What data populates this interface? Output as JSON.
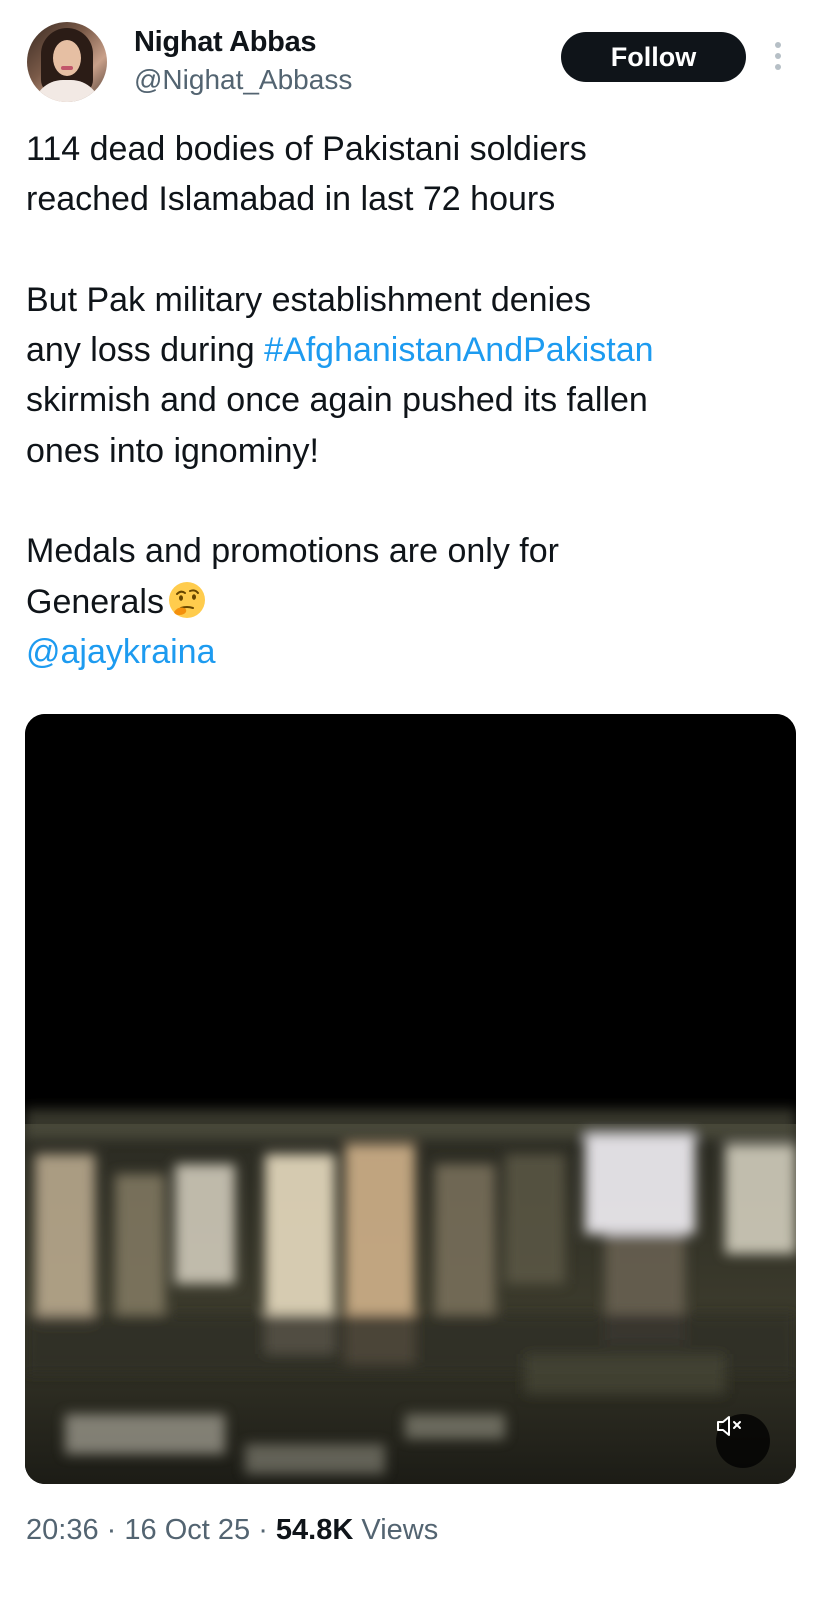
{
  "author": {
    "display_name": "Nighat Abbas",
    "handle": "@Nighat_Abbass",
    "avatar_icon": "profile-photo"
  },
  "header": {
    "follow_label": "Follow",
    "more_icon": "vertical-ellipsis-icon"
  },
  "tweet": {
    "paragraph1": {
      "line1": "114 dead bodies of Pakistani soldiers",
      "line2": "reached Islamabad in last 72 hours"
    },
    "paragraph2": {
      "line1": "But Pak military establishment denies",
      "line2_prefix": "any loss during ",
      "hashtag": "#AfghanistanAndPakistan",
      "line3": "skirmish and once again pushed its fallen",
      "line4": "ones into ignominy!"
    },
    "paragraph3": {
      "line1": "Medals and promotions are only for",
      "line2": "Generals",
      "emoji": "thinking-face-emoji",
      "mention": "@ajaykraina"
    }
  },
  "media": {
    "type": "video",
    "mute_icon": "speaker-muted-icon"
  },
  "meta": {
    "time": "20:36",
    "separator": "·",
    "date": "16 Oct 25",
    "views_count": "54.8K",
    "views_label": "Views"
  },
  "colors": {
    "link": "#1d9bf0",
    "text": "#0f1419",
    "secondary": "#536471",
    "button_bg": "#0f1419",
    "button_text": "#ffffff"
  }
}
